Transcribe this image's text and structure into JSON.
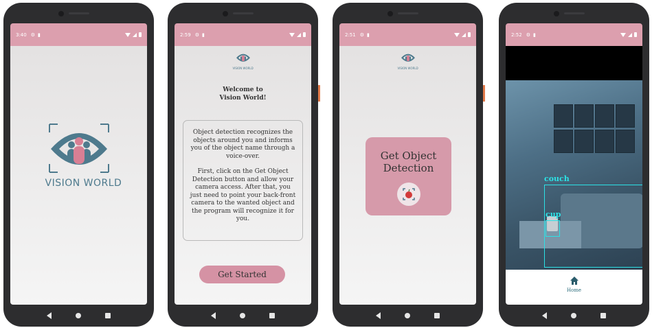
{
  "colors": {
    "status_bar": "#dc9fae",
    "accent_pink": "#d592a4",
    "logo_teal": "#4e7a8d",
    "detection": "#2ce2e6"
  },
  "phone1": {
    "status": {
      "time": "3:40"
    },
    "logo_text": "VISION WORLD"
  },
  "phone2": {
    "status": {
      "time": "2:59"
    },
    "logo_tiny": "VISION WORLD",
    "welcome": "Welcome to\nVision World!",
    "description_p1": "Object detection recognizes the objects around you and informs you of the object name through a voice-over.",
    "description_p2": "First, click on the Get Object Detection button and allow your camera access. After that, you just need to point your back-front camera to the wanted object and the program will recognize it for you.",
    "button_label": "Get Started"
  },
  "phone3": {
    "status": {
      "time": "2:51"
    },
    "logo_tiny": "VISION WORLD",
    "card_title": "Get Object\nDetection",
    "card_icon": "apple-scan-icon"
  },
  "phone4": {
    "status": {
      "time": "2:52"
    },
    "detections": [
      {
        "label": "couch"
      },
      {
        "label": "cup"
      }
    ],
    "nav_home_label": "Home"
  },
  "icons": {
    "settings": "gear-icon",
    "sdcard": "sd-card-icon",
    "wifi": "wifi-icon",
    "signal": "signal-icon",
    "battery": "battery-icon",
    "back": "nav-back-icon",
    "home": "nav-home-icon",
    "recent": "nav-recent-icon"
  }
}
